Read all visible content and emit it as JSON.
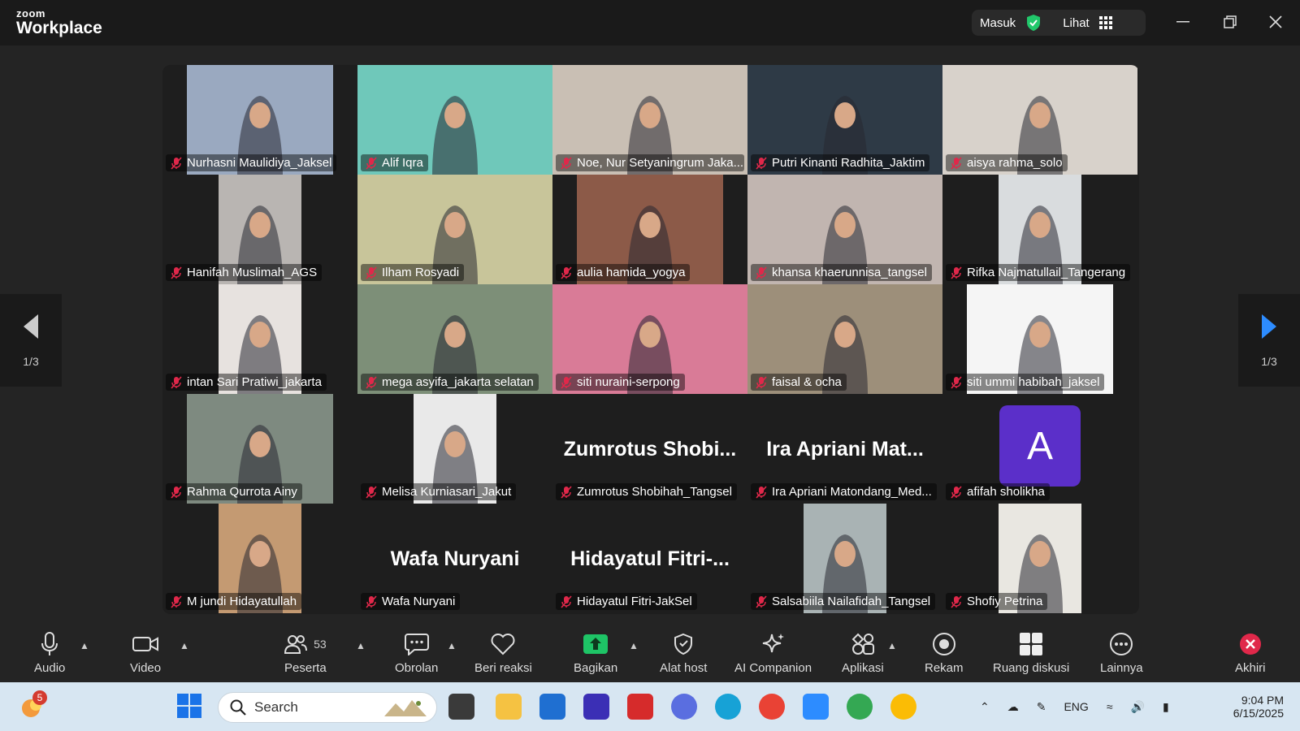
{
  "app": {
    "logo_small": "zoom",
    "logo_big": "Workplace"
  },
  "titlebar": {
    "sign_in": "Masuk",
    "view": "Lihat"
  },
  "page_indicator": "1/3",
  "participants": [
    {
      "name": "Nurhasni Maulidiya_Jaksel",
      "bg": "#9aa9c0"
    },
    {
      "name": "Alif Iqra",
      "bg": "#6fc8ba",
      "active": true
    },
    {
      "name": "Noe, Nur Setyaningrum Jaka...",
      "bg": "#c9bfb4"
    },
    {
      "name": "Putri Kinanti Radhita_Jaktim",
      "bg": "#2e3a46"
    },
    {
      "name": "aisya rahma_solo",
      "bg": "#d8d2cb"
    },
    {
      "name": "Hanifah Muslimah_AGS",
      "bg": "#b9b5b2"
    },
    {
      "name": "Ilham Rosyadi",
      "bg": "#c8c59a"
    },
    {
      "name": "aulia hamida_yogya",
      "bg": "#8c5a48"
    },
    {
      "name": "khansa khaerunnisa_tangsel",
      "bg": "#c1b5b0"
    },
    {
      "name": "Rifka Najmatullail_Tangerang",
      "bg": "#d9dcde"
    },
    {
      "name": "intan Sari Pratiwi_jakarta",
      "bg": "#e7e2df"
    },
    {
      "name": "mega asyifa_jakarta selatan",
      "bg": "#7d8f78"
    },
    {
      "name": "siti nuraini-serpong",
      "bg": "#d97b97"
    },
    {
      "name": "faisal & ocha",
      "bg": "#9d8f7a"
    },
    {
      "name": "siti ummi habibah_jaksel",
      "bg": "#f5f5f5"
    },
    {
      "name": "Rahma Qurrota Ainy",
      "bg": "#7e8a80"
    },
    {
      "name": "Melisa Kurniasari_Jakut",
      "bg": "#e9e9e9"
    },
    {
      "name": "Zumrotus Shobihah_Tangsel",
      "big": "Zumrotus  Shobi..."
    },
    {
      "name": "Ira Apriani Matondang_Med...",
      "big": "Ira  Apriani  Mat..."
    },
    {
      "name": "afifah sholikha",
      "avatar": "A"
    },
    {
      "name": "M jundi Hidayatullah",
      "bg": "#c49a72"
    },
    {
      "name": "Wafa Nuryani",
      "big": "Wafa  Nuryani"
    },
    {
      "name": "Hidayatul Fitri-JakSel",
      "big": "Hidayatul  Fitri-..."
    },
    {
      "name": "Salsabiila Nailafidah_Tangsel",
      "bg": "#a9b3b4"
    },
    {
      "name": "Shofiy Petrina",
      "bg": "#e9e7e1"
    }
  ],
  "toolbar": {
    "audio": "Audio",
    "video": "Video",
    "participants": "Peserta",
    "participant_count": "53",
    "chat": "Obrolan",
    "react": "Beri reaksi",
    "share": "Bagikan",
    "host_tools": "Alat host",
    "ai": "AI Companion",
    "apps": "Aplikasi",
    "record": "Rekam",
    "breakout": "Ruang diskusi",
    "more": "Lainnya",
    "end": "Akhiri"
  },
  "taskbar": {
    "weather_badge": "5",
    "search_placeholder": "Search",
    "lang": "ENG",
    "time": "9:04 PM",
    "date": "6/15/2025"
  },
  "colors": {
    "accent": "#21c86b",
    "share": "#1ec466",
    "end": "#e0284a",
    "avatar": "#5b2fc9"
  }
}
